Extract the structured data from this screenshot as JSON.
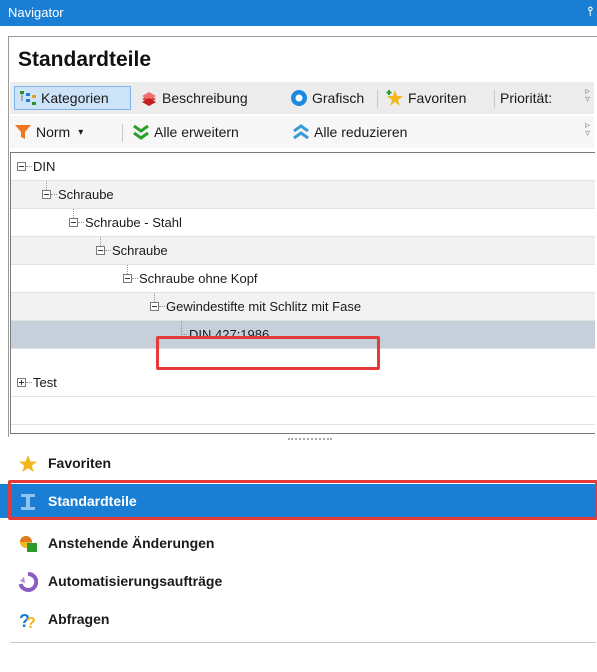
{
  "window": {
    "title": "Navigator",
    "pin": "ᵖ"
  },
  "header": {
    "title": "Standardteile"
  },
  "toolbar1": {
    "kategorien": "Kategorien",
    "beschreibung": "Beschreibung",
    "grafisch": "Grafisch",
    "favoriten": "Favoriten",
    "prioritaet": "Priorität:"
  },
  "toolbar2": {
    "norm": "Norm",
    "alle_erweitern": "Alle erweitern",
    "alle_reduzieren": "Alle reduzieren"
  },
  "tree": {
    "items": [
      "DIN",
      "Schraube",
      "Schraube - Stahl",
      "Schraube",
      "Schraube ohne Kopf",
      "Gewindestifte mit Schlitz mit Fase",
      "DIN 427:1986",
      "Test"
    ]
  },
  "nav": {
    "favoriten": "Favoriten",
    "standardteile": "Standardteile",
    "anstehende": "Anstehende Änderungen",
    "automatisierung": "Automatisierungsaufträge",
    "abfragen": "Abfragen"
  },
  "colors": {
    "accent": "#1a7fd4",
    "highlight": "#e53a3a",
    "selected_row": "#c6d0db"
  }
}
